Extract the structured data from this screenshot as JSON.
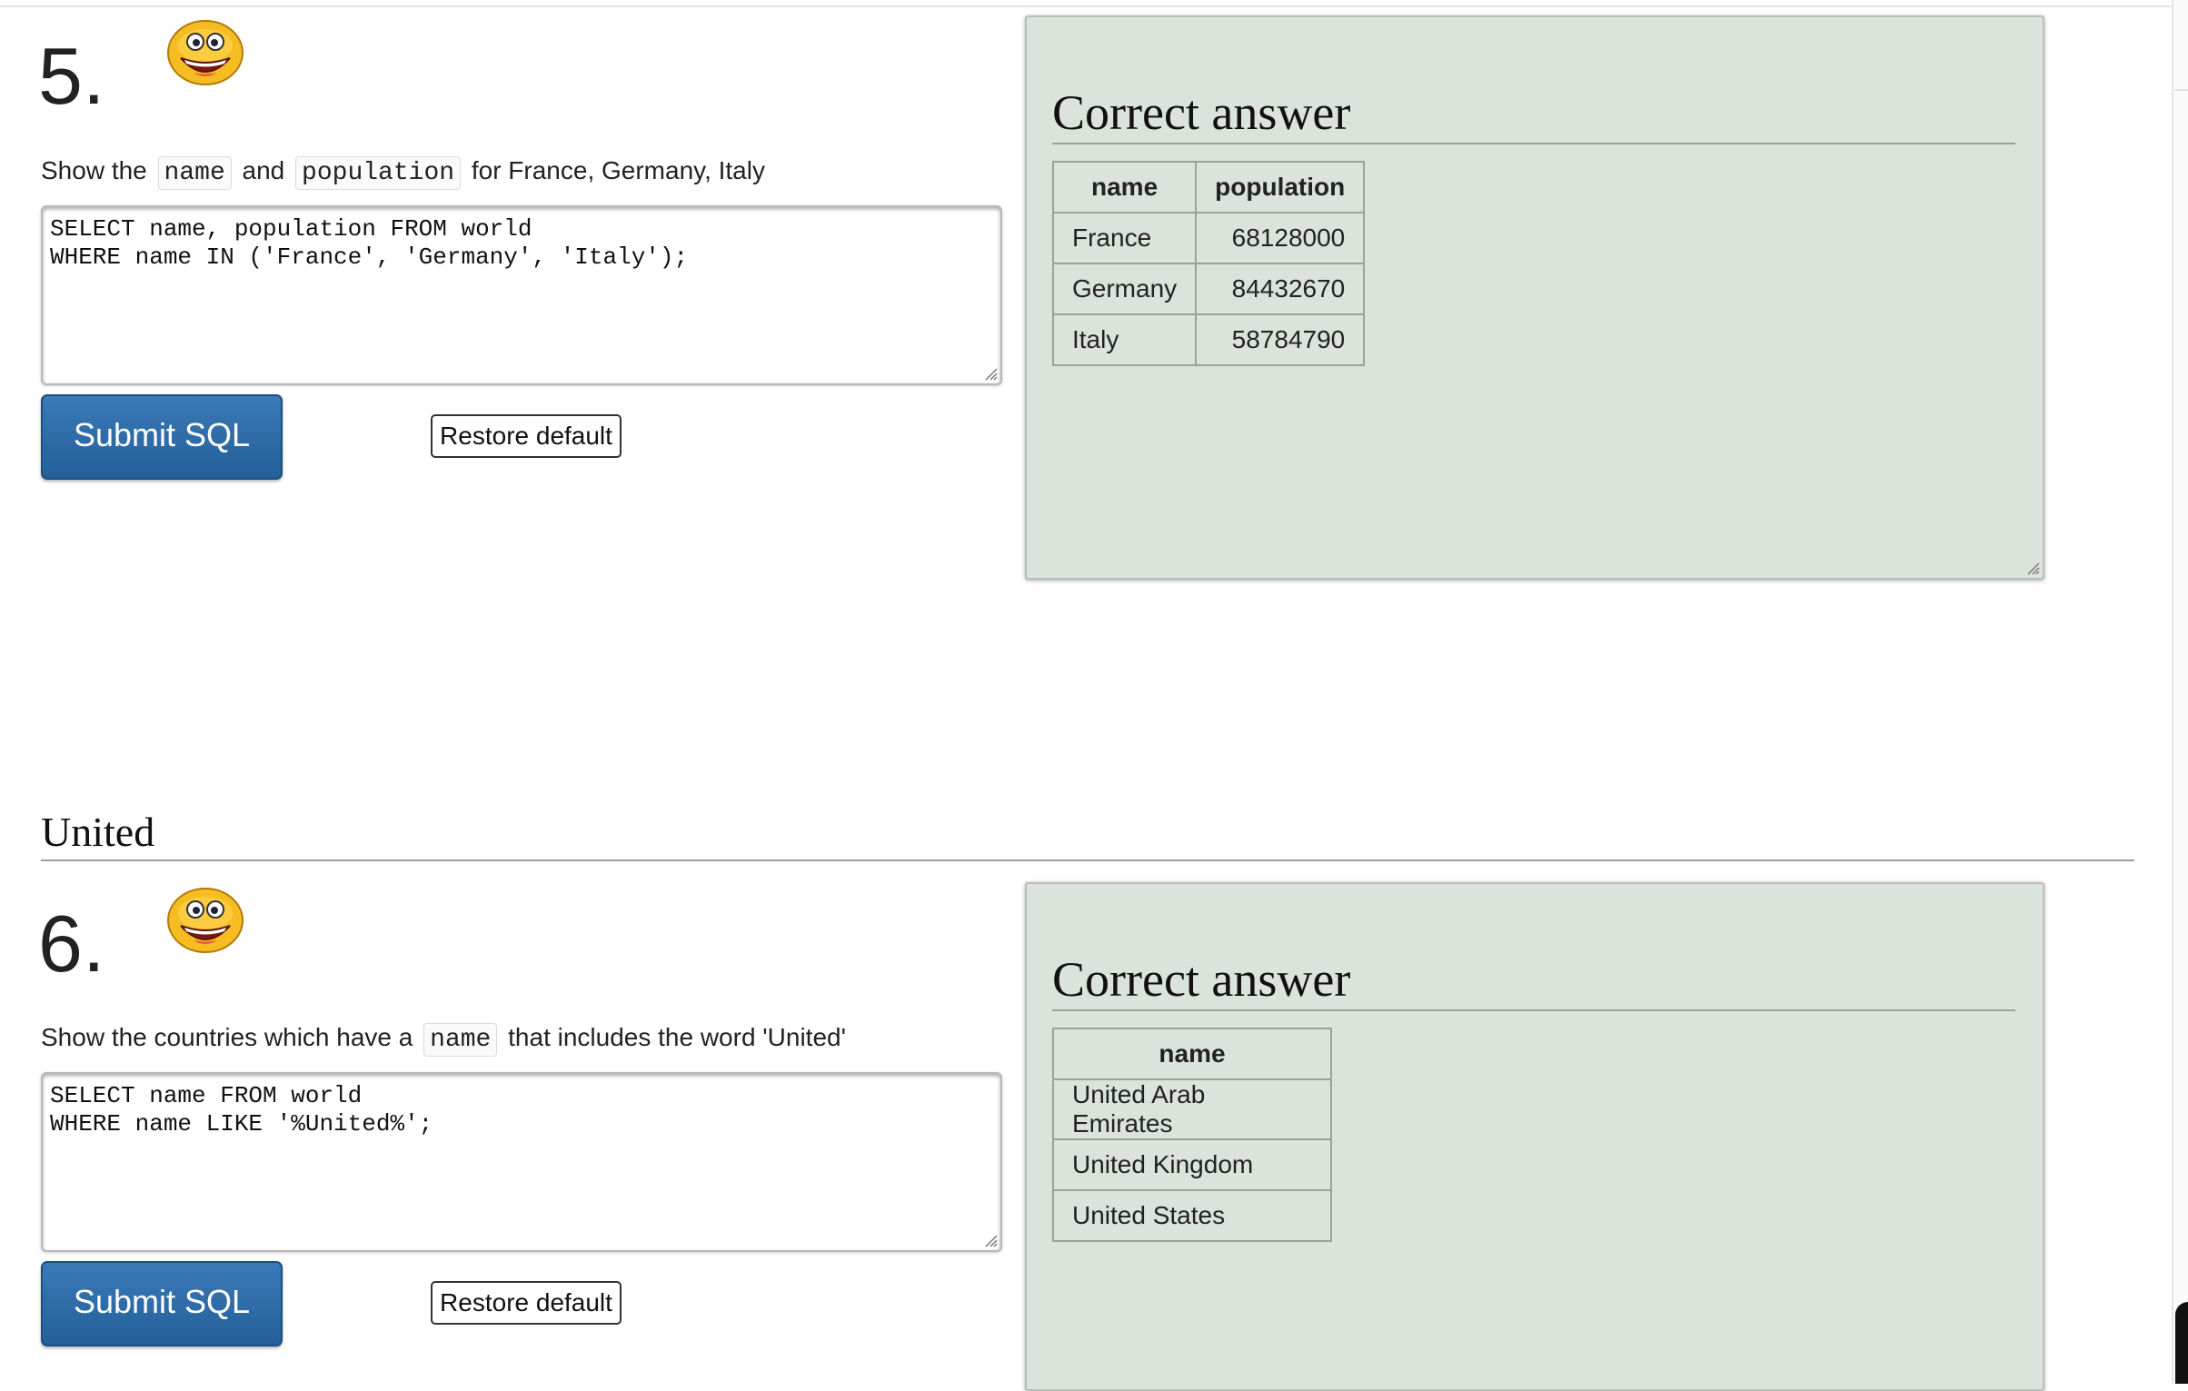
{
  "q5": {
    "number": "5.",
    "prompt_pre": "Show the",
    "kw1": "name",
    "prompt_mid": "and",
    "kw2": "population",
    "prompt_post": "for France, Germany, Italy",
    "sql": "SELECT name, population FROM world\nWHERE name IN ('France', 'Germany', 'Italy');",
    "submit_label": "Submit SQL",
    "restore_label": "Restore default",
    "answer": {
      "title": "Correct answer",
      "headers": [
        "name",
        "population"
      ],
      "rows": [
        [
          "France",
          "68128000"
        ],
        [
          "Germany",
          "84432670"
        ],
        [
          "Italy",
          "58784790"
        ]
      ]
    }
  },
  "section": {
    "title": "United"
  },
  "q6": {
    "number": "6.",
    "prompt_pre": "Show the countries which have a",
    "kw1": "name",
    "prompt_post": "that includes the word 'United'",
    "sql": "SELECT name FROM world\nWHERE name LIKE '%United%';",
    "submit_label": "Submit SQL",
    "restore_label": "Restore default",
    "answer": {
      "title": "Correct answer",
      "headers": [
        "name"
      ],
      "rows": [
        [
          "United Arab Emirates"
        ],
        [
          "United Kingdom"
        ],
        [
          "United States"
        ]
      ]
    }
  },
  "colors": {
    "submit_button": "#2d6ba8",
    "answer_panel": "#dbe4da",
    "smiley": "#f4b81c"
  },
  "icons": {
    "status": "smiley-face-icon",
    "resize": "resize-grip-icon"
  }
}
